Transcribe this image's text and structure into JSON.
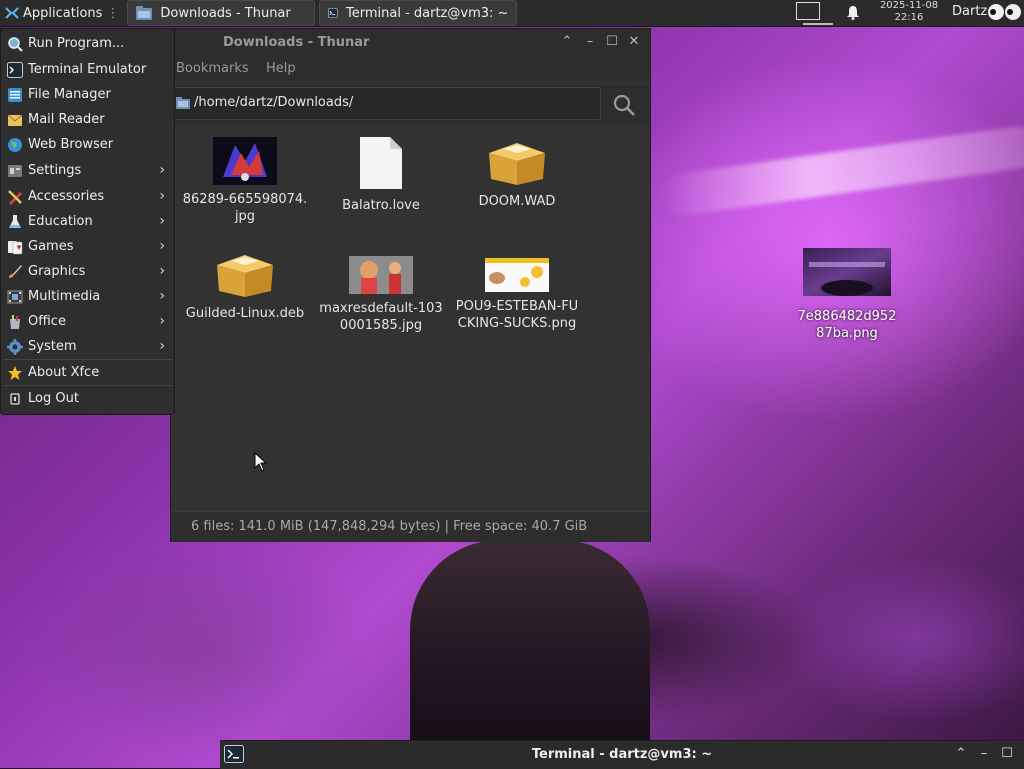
{
  "top_panel": {
    "applications_label": "Applications",
    "tasks": [
      {
        "label": "Downloads - Thunar",
        "icon": "folder-icon"
      },
      {
        "label": "Terminal - dartz@vm3: ~",
        "icon": "terminal-icon"
      }
    ],
    "clock_date": "2025-11-08",
    "clock_time": "22:16",
    "user": "Dartz"
  },
  "app_menu": {
    "items": [
      {
        "label": "Run Program...",
        "icon": "run-icon",
        "submenu": false
      },
      {
        "label": "Terminal Emulator",
        "icon": "terminal-icon",
        "submenu": false
      },
      {
        "label": "File Manager",
        "icon": "file-manager-icon",
        "submenu": false
      },
      {
        "label": "Mail Reader",
        "icon": "mail-icon",
        "submenu": false
      },
      {
        "label": "Web Browser",
        "icon": "globe-icon",
        "submenu": false
      },
      {
        "label": "Settings",
        "icon": "settings-icon",
        "submenu": true
      },
      {
        "label": "Accessories",
        "icon": "accessories-icon",
        "submenu": true
      },
      {
        "label": "Education",
        "icon": "flask-icon",
        "submenu": true
      },
      {
        "label": "Games",
        "icon": "cards-icon",
        "submenu": true
      },
      {
        "label": "Graphics",
        "icon": "brush-icon",
        "submenu": true
      },
      {
        "label": "Multimedia",
        "icon": "film-icon",
        "submenu": true
      },
      {
        "label": "Office",
        "icon": "office-icon",
        "submenu": true
      },
      {
        "label": "System",
        "icon": "gear-icon",
        "submenu": true
      },
      {
        "label": "About Xfce",
        "icon": "star-icon",
        "submenu": false
      },
      {
        "label": "Log Out",
        "icon": "logout-icon",
        "submenu": false
      }
    ]
  },
  "thunar": {
    "title": "Downloads - Thunar",
    "menubar": [
      "Bookmarks",
      "Help"
    ],
    "location": "/home/dartz/Downloads/",
    "files": [
      {
        "name": "86289-665598074.jpg",
        "thumb": "image-thumb-dark"
      },
      {
        "name": "Balatro.love",
        "thumb": "blank-file-icon"
      },
      {
        "name": "DOOM.WAD",
        "thumb": "package-box-icon"
      },
      {
        "name": "Guilded-Linux.deb",
        "thumb": "package-box-icon"
      },
      {
        "name": "maxresdefault-1030001585.jpg",
        "thumb": "image-thumb-cartoon"
      },
      {
        "name": "POU9-ESTEBAN-FUCKING-SUCKS.png",
        "thumb": "image-thumb-pou"
      }
    ],
    "status": "6 files: 141.0 MiB (147,848,294 bytes)  |  Free space: 40.7 GiB"
  },
  "desktop": {
    "icon_label": "7e886482d95287ba.png"
  },
  "bottom_panel": {
    "title": "Terminal - dartz@vm3: ~"
  }
}
